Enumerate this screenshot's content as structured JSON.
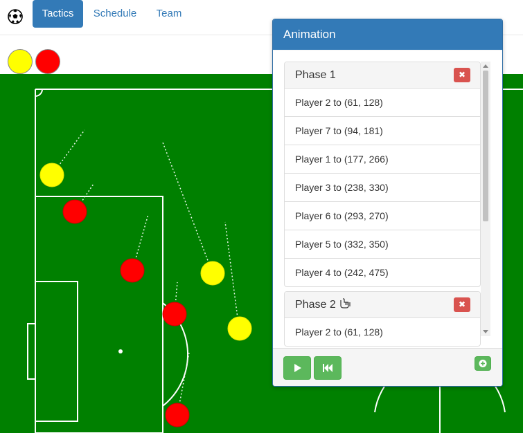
{
  "nav": {
    "brand_icon": "soccer-ball-icon",
    "tabs": [
      {
        "label": "Tactics",
        "active": true
      },
      {
        "label": "Schedule",
        "active": false
      },
      {
        "label": "Team",
        "active": false
      }
    ]
  },
  "palette": {
    "team_colors": [
      "#ffff00",
      "#ff0000"
    ],
    "pitch": "#008000",
    "accent": "#337ab7",
    "danger": "#d9534f",
    "success": "#5cb85c"
  },
  "animation_panel": {
    "title": "Animation",
    "phases": [
      {
        "title": "Phase 1",
        "moves": [
          "Player 2 to (61, 128)",
          "Player 7 to (94, 181)",
          "Player 1 to (177, 266)",
          "Player 3 to (238, 330)",
          "Player 6 to (293, 270)",
          "Player 5 to (332, 350)",
          "Player 4 to (242, 475)"
        ]
      },
      {
        "title": "Phase 2",
        "moves": [
          "Player 2 to (61, 128)"
        ]
      }
    ],
    "controls": [
      "play-icon",
      "rewind-icon",
      "add-icon"
    ]
  }
}
